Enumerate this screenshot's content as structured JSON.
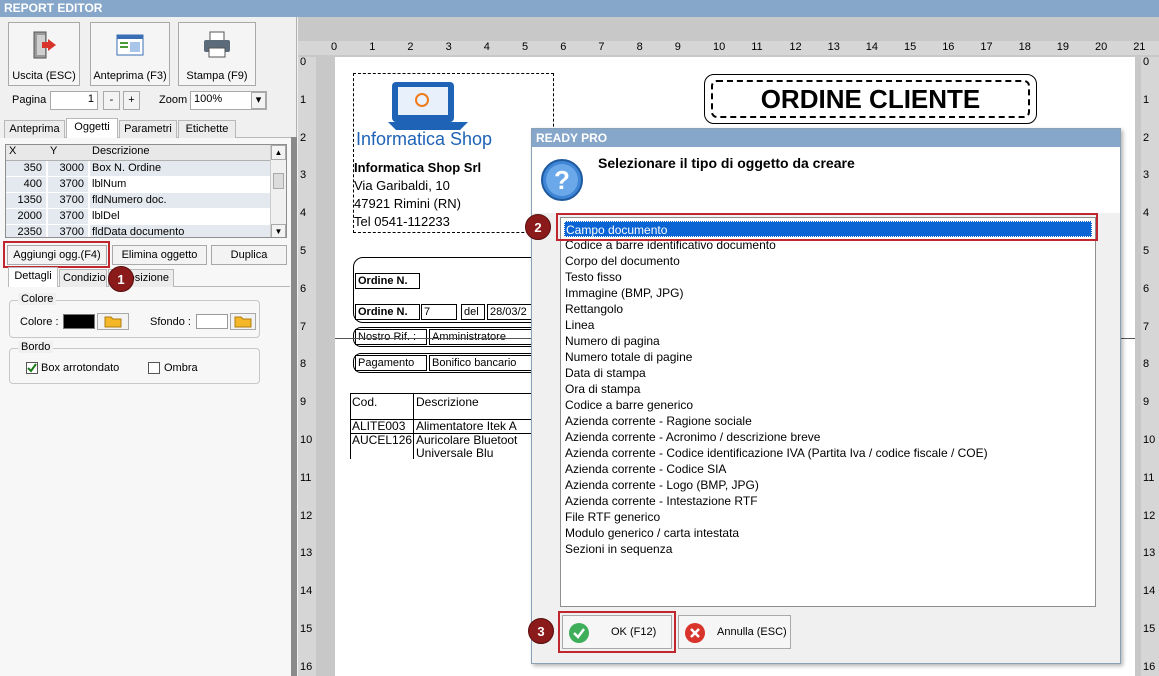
{
  "window": {
    "title": "REPORT EDITOR"
  },
  "toolbar": {
    "exit_label": "Uscita (ESC)",
    "preview_label": "Anteprima (F3)",
    "print_label": "Stampa (F9)",
    "page_label": "Pagina",
    "page_value": "1",
    "minus": "-",
    "plus": "+",
    "zoom_label": "Zoom",
    "zoom_value": "100%"
  },
  "main_tabs": {
    "t1": "Anteprima",
    "t2": "Oggetti",
    "t3": "Parametri",
    "t4": "Etichette"
  },
  "grid": {
    "headers": {
      "x": "X",
      "y": "Y",
      "desc": "Descrizione"
    },
    "rows": [
      {
        "x": "350",
        "y": "3000",
        "desc": "Box N. Ordine"
      },
      {
        "x": "400",
        "y": "3700",
        "desc": "lblNum"
      },
      {
        "x": "1350",
        "y": "3700",
        "desc": "fldNumero doc."
      },
      {
        "x": "2000",
        "y": "3700",
        "desc": "lblDel"
      },
      {
        "x": "2350",
        "y": "3700",
        "desc": "fldData documento"
      }
    ]
  },
  "object_buttons": {
    "add": "Aggiungi ogg.(F4)",
    "delete": "Elimina oggetto",
    "duplicate": "Duplica"
  },
  "sub_tabs": {
    "t1": "Dettagli",
    "t2": "Condizio",
    "t3": "osizione"
  },
  "colore": {
    "title": "Colore",
    "label": "Colore :",
    "sfondo_label": "Sfondo :"
  },
  "bordo": {
    "title": "Bordo",
    "rounded": "Box arrotondato",
    "shadow": "Ombra"
  },
  "badges": {
    "b1": "1",
    "b2": "2",
    "b3": "3"
  },
  "ruler": {
    "h": [
      "0",
      "1",
      "2",
      "3",
      "4",
      "5",
      "6",
      "7",
      "8",
      "9",
      "10",
      "11",
      "12",
      "13",
      "14",
      "15",
      "16",
      "17",
      "18",
      "19",
      "20",
      "21"
    ],
    "v": [
      "0",
      "1",
      "2",
      "3",
      "4",
      "5",
      "6",
      "7",
      "8",
      "9",
      "10",
      "11",
      "12",
      "13",
      "14",
      "15",
      "16"
    ]
  },
  "report": {
    "logo_text": "Informatica Shop",
    "title": "ORDINE CLIENTE",
    "company": "Informatica Shop Srl",
    "address1": "Via Garibaldi, 10",
    "address2": "47921 Rimini (RN)",
    "phone": "Tel 0541-112233",
    "ordine_n_1": "Ordine N.",
    "ordine_n_2": "Ordine N.",
    "num_value": "7",
    "del": "del",
    "date_value": "28/03/2",
    "nostro_rif": "Nostro Rif. :",
    "amministratore": "Amministratore",
    "pagamento": "Pagamento",
    "bonifico": "Bonifico bancario",
    "col_cod": "Cod.",
    "col_desc": "Descrizione",
    "r1_cod": "ALITE003",
    "r1_desc": "Alimentatore Itek A",
    "r2_cod": "AUCEL126",
    "r2_desc": "Auricolare Bluetoot",
    "r2_desc2": "Universale Blu"
  },
  "dialog": {
    "title": "READY PRO",
    "question": "Selezionare il tipo di oggetto da creare",
    "items": [
      "Campo documento",
      "Codice a barre identificativo documento",
      "Corpo del documento",
      "Testo fisso",
      "Immagine (BMP, JPG)",
      "Rettangolo",
      "Linea",
      "Numero di pagina",
      "Numero totale di pagine",
      "Data di stampa",
      "Ora di stampa",
      "Codice a barre generico",
      "Azienda corrente - Ragione sociale",
      "Azienda corrente - Acronimo / descrizione breve",
      "Azienda corrente - Codice identificazione IVA (Partita Iva / codice fiscale / COE)",
      "Azienda corrente - Codice SIA",
      "Azienda corrente - Logo (BMP, JPG)",
      "Azienda corrente - Intestazione RTF",
      "File RTF generico",
      "Modulo generico / carta intestata",
      "Sezioni in sequenza"
    ],
    "ok_label": "OK (F12)",
    "cancel_label": "Annulla (ESC)"
  }
}
